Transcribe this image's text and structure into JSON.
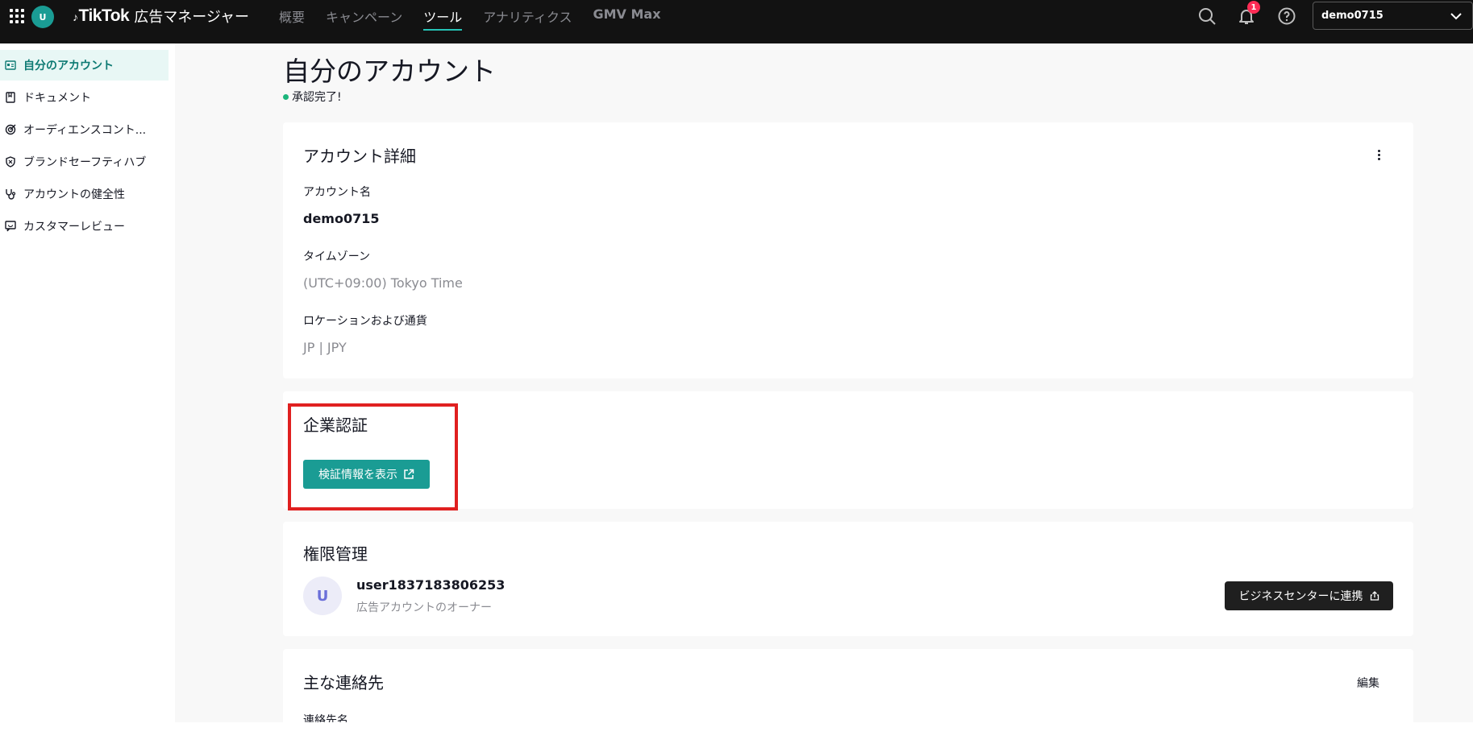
{
  "topbar": {
    "avatar_letter": "U",
    "logo_text": "TikTok",
    "product_name": "広告マネージャー",
    "nav": [
      {
        "label": "概要",
        "active": false
      },
      {
        "label": "キャンペーン",
        "active": false
      },
      {
        "label": "ツール",
        "active": true
      },
      {
        "label": "アナリティクス",
        "active": false
      },
      {
        "label": "GMV Max",
        "active": false
      }
    ],
    "notification_count": "1",
    "account_selector": "demo0715"
  },
  "sidebar": {
    "items": [
      {
        "label": "自分のアカウント",
        "icon": "id-card-icon",
        "active": true
      },
      {
        "label": "ドキュメント",
        "icon": "document-icon",
        "active": false
      },
      {
        "label": "オーディエンスコント...",
        "icon": "target-icon",
        "active": false
      },
      {
        "label": "ブランドセーフティハブ",
        "icon": "shield-icon",
        "active": false
      },
      {
        "label": "アカウントの健全性",
        "icon": "stethoscope-icon",
        "active": false
      },
      {
        "label": "カスタマーレビュー",
        "icon": "review-icon",
        "active": false
      }
    ]
  },
  "main": {
    "title": "自分のアカウント",
    "status": "承認完了!",
    "account_details": {
      "title": "アカウント詳細",
      "name_label": "アカウント名",
      "name_value": "demo0715",
      "timezone_label": "タイムゾーン",
      "timezone_value": "(UTC+09:00) Tokyo Time",
      "location_label": "ロケーションおよび通貨",
      "location_value": "JP | JPY"
    },
    "verification": {
      "title": "企業認証",
      "button_label": "検証情報を表示"
    },
    "permissions": {
      "title": "権限管理",
      "avatar_letter": "U",
      "user_name": "user1837183806253",
      "user_role": "広告アカウントのオーナー",
      "button_label": "ビジネスセンターに連携"
    },
    "contact": {
      "title": "主な連絡先",
      "edit_label": "編集",
      "contact_name_label": "連絡先名"
    }
  },
  "colors": {
    "accent": "#1a9c94",
    "topbar_bg": "#121212",
    "highlight": "#e02020",
    "status_dot": "#1bb57b",
    "badge": "#fe2c55"
  }
}
